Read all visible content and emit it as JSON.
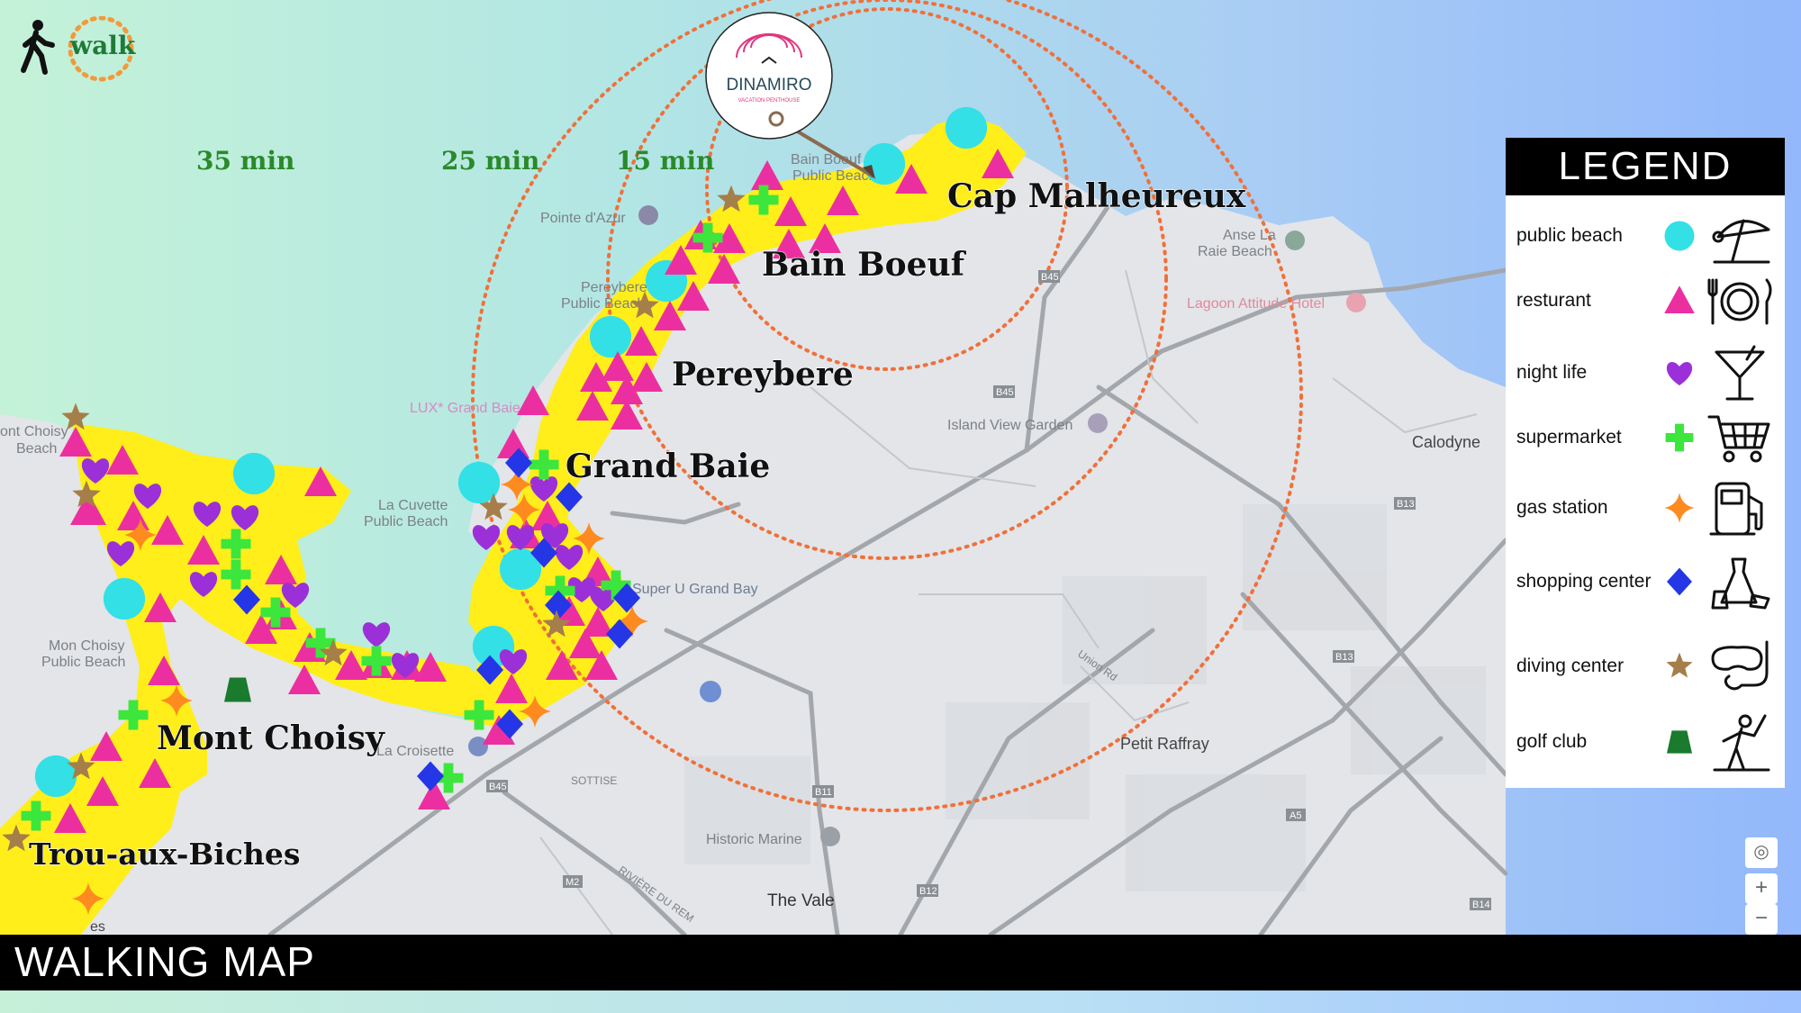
{
  "walk_badge": {
    "label": "walk"
  },
  "rings": [
    {
      "label": "15 min"
    },
    {
      "label": "25 min"
    },
    {
      "label": "35 min"
    }
  ],
  "logo": {
    "name": "DINAMIRO",
    "tagline": "VACATION PENTHOUSE"
  },
  "towns": [
    "Cap Malheureux",
    "Bain Boeuf",
    "Pereybere",
    "Grand Baie",
    "Mont Choisy",
    "Trou-aux-Biches"
  ],
  "map_labels": {
    "pointe_dazur": "Pointe d'Azur",
    "pereybere_beach_1": "Pereybere",
    "pereybere_beach_2": "Public Beach",
    "bain_boeuf_small_1": "Bain Boeuf",
    "bain_boeuf_small_2": "Public Beach",
    "anse_la_raie_1": "Anse La",
    "anse_la_raie_2": "Raie Beach",
    "lagoon_hotel": "Lagoon Attitude Hotel",
    "lux_grand_baie": "LUX* Grand Baie",
    "island_view": "Island View Garden",
    "calodyne": "Calodyne",
    "la_cuvette_1": "La Cuvette",
    "la_cuvette_2": "Public Beach",
    "mont_choisy_beach_1": "Mon Choisy",
    "mont_choisy_beach_2": "Public Beach",
    "mont_choisy_beach_top_1": "ont Choisy",
    "mont_choisy_beach_top_2": "Beach",
    "super_u": "Super U Grand Bay",
    "la_croisette": "La Croisette",
    "sottise": "SOTTISE",
    "petit_raffray": "Petit Raffray",
    "historic_marine": "Historic Marine",
    "the_vale": "The Vale",
    "union_rd": "Union Rd",
    "riviere": "RIVIÈRE DU REM",
    "es": "es",
    "b45": "B45",
    "b13": "B13",
    "b11": "B11",
    "a5": "A5",
    "m2": "M2",
    "b12": "B12",
    "b14": "B14"
  },
  "legend": {
    "title": "LEGEND",
    "items": [
      {
        "label": "public beach",
        "symbol": "circle",
        "color": "#33e0e6",
        "icon": "beach-umbrella-icon"
      },
      {
        "label": "resturant",
        "symbol": "triangle",
        "color": "#ec2fa0",
        "icon": "plate-cutlery-icon"
      },
      {
        "label": "night life",
        "symbol": "heart",
        "color": "#9b30d8",
        "icon": "cocktail-icon"
      },
      {
        "label": "supermarket",
        "symbol": "plus",
        "color": "#3ce63c",
        "icon": "shopping-cart-icon"
      },
      {
        "label": "gas station",
        "symbol": "sparkle",
        "color": "#ff8a1f",
        "icon": "fuel-pump-icon"
      },
      {
        "label": "shopping center",
        "symbol": "diamond",
        "color": "#2436e6",
        "icon": "dress-shopping-icon"
      },
      {
        "label": "diving center",
        "symbol": "star",
        "color": "#a57e4a",
        "icon": "diving-mask-icon"
      },
      {
        "label": "golf club",
        "symbol": "trapezoid",
        "color": "#1a7a2e",
        "icon": "golfer-icon"
      }
    ]
  },
  "map_controls": {
    "zoom_in": "+",
    "zoom_out": "−"
  },
  "footer": {
    "title": "WALKING MAP"
  },
  "colors": {
    "walk_zone": "#ffee1a",
    "ring": "#f0703a",
    "sea_left": "#b7ecd6",
    "sea_right": "#8fbaf8",
    "ring_label": "#2a8a2a"
  }
}
